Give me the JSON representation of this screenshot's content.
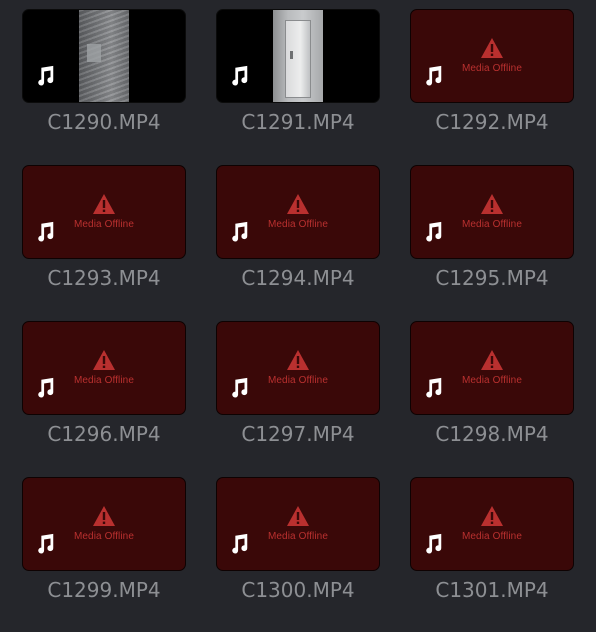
{
  "media_pool": {
    "offline_label": "Media Offline",
    "clips": [
      {
        "name": "C1290.MP4",
        "status": "video",
        "icon": "music-note-icon"
      },
      {
        "name": "C1291.MP4",
        "status": "video",
        "icon": "music-note-icon"
      },
      {
        "name": "C1292.MP4",
        "status": "offline",
        "icon": "music-note-icon"
      },
      {
        "name": "C1293.MP4",
        "status": "offline",
        "icon": "music-note-icon"
      },
      {
        "name": "C1294.MP4",
        "status": "offline",
        "icon": "music-note-icon"
      },
      {
        "name": "C1295.MP4",
        "status": "offline",
        "icon": "music-note-icon"
      },
      {
        "name": "C1296.MP4",
        "status": "offline",
        "icon": "music-note-icon"
      },
      {
        "name": "C1297.MP4",
        "status": "offline",
        "icon": "music-note-icon"
      },
      {
        "name": "C1298.MP4",
        "status": "offline",
        "icon": "music-note-icon"
      },
      {
        "name": "C1299.MP4",
        "status": "offline",
        "icon": "music-note-icon"
      },
      {
        "name": "C1300.MP4",
        "status": "offline",
        "icon": "music-note-icon"
      },
      {
        "name": "C1301.MP4",
        "status": "offline",
        "icon": "music-note-icon"
      }
    ]
  },
  "colors": {
    "background": "#25262b",
    "offline_fill": "#3a0808",
    "offline_text": "#b9302f",
    "clip_name": "#8d8f93",
    "icon": "#ffffff"
  }
}
